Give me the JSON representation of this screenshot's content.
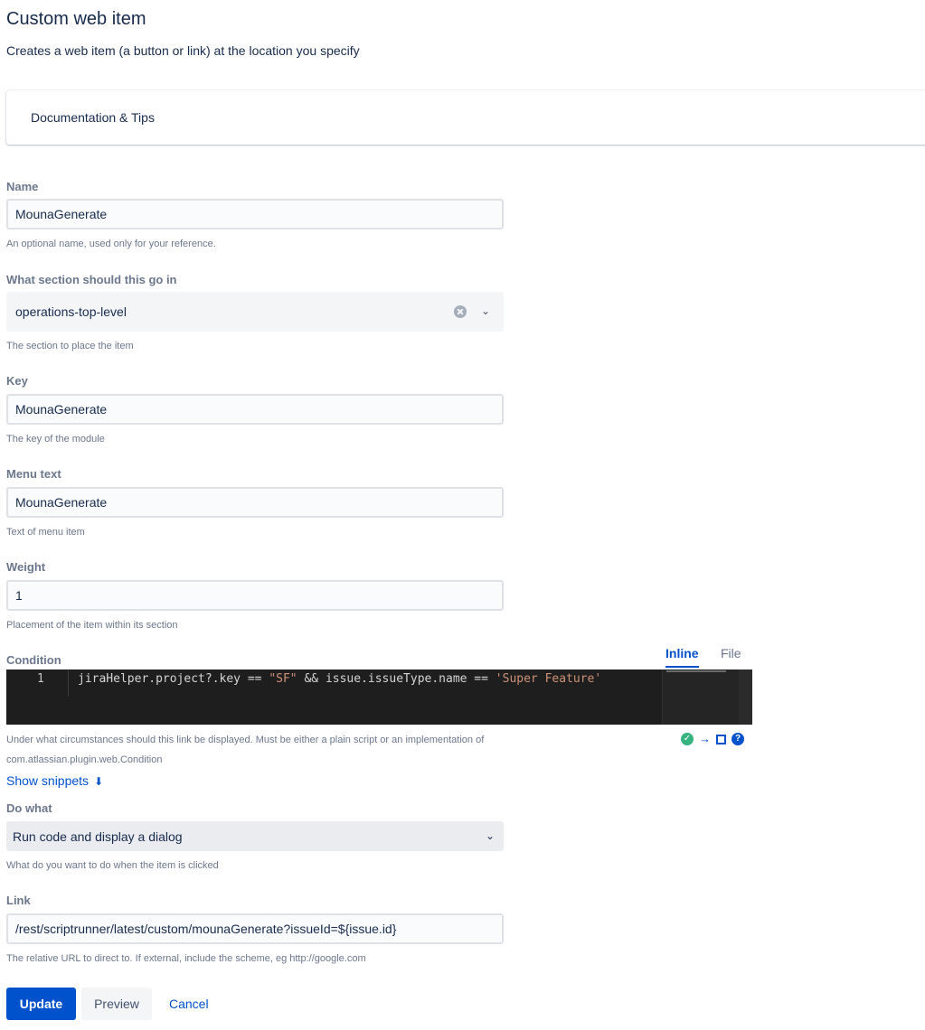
{
  "header": {
    "title": "Custom web item",
    "subtitle": "Creates a web item (a button or link) at the location you specify"
  },
  "docs": {
    "label": "Documentation & Tips"
  },
  "fields": {
    "name": {
      "label": "Name",
      "value": "MounaGenerate",
      "help": "An optional name, used only for your reference."
    },
    "section": {
      "label": "What section should this go in",
      "value": "operations-top-level",
      "help": "The section to place the item"
    },
    "key": {
      "label": "Key",
      "value": "MounaGenerate",
      "help": "The key of the module"
    },
    "menu_text": {
      "label": "Menu text",
      "value": "MounaGenerate",
      "help": "Text of menu item"
    },
    "weight": {
      "label": "Weight",
      "value": "1",
      "help": "Placement of the item within its section"
    },
    "condition": {
      "label": "Condition",
      "tabs": {
        "inline": "Inline",
        "file": "File"
      },
      "line_number": "1",
      "code_part1": "jiraHelper.project?.key == ",
      "code_str1": "\"SF\"",
      "code_part2": " && issue.issueType.name == ",
      "code_str2": "'Super Feature'",
      "help_line1": "Under what circumstances should this link be displayed. Must be either a plain script or an implementation of",
      "help_line2": "com.atlassian.plugin.web.Condition",
      "show_snippets": "Show snippets"
    },
    "do_what": {
      "label": "Do what",
      "value": "Run code and display a dialog",
      "help": "What do you want to do when the item is clicked"
    },
    "link": {
      "label": "Link",
      "value": "/rest/scriptrunner/latest/custom/mounaGenerate?issueId=${issue.id}",
      "help": "The relative URL to direct to. If external, include the scheme, eg http://google.com"
    }
  },
  "buttons": {
    "update": "Update",
    "preview": "Preview",
    "cancel": "Cancel"
  },
  "icons": {
    "clear": "clear-icon",
    "chevron": "chevron-down-icon",
    "double_chevron": "double-chevron-down-icon",
    "valid": "check-circle-icon",
    "arrow": "arrow-right-icon",
    "expand": "fullscreen-icon",
    "help": "help-icon"
  },
  "colors": {
    "primary": "#0052cc",
    "success": "#36b37e",
    "editor_bg": "#1e1e1e",
    "string": "#ce9178"
  }
}
